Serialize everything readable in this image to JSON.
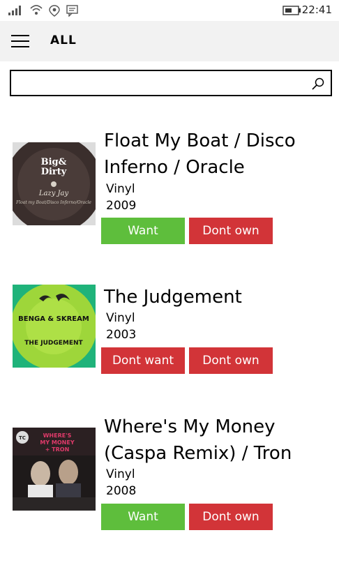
{
  "status_bar": {
    "time": "22:41"
  },
  "header": {
    "title": "ALL"
  },
  "search": {
    "value": "",
    "placeholder": ""
  },
  "items": [
    {
      "title": "Float My Boat / Disco Inferno / Oracle",
      "format": "Vinyl",
      "year": "2009",
      "want_label": "Want",
      "own_label": "Dont own",
      "cover": {
        "art_text": "Big & Dirty",
        "sub_text": "Lazy Jay"
      }
    },
    {
      "title": "The Judgement",
      "format": "Vinyl",
      "year": "2003",
      "want_label": "Dont want",
      "own_label": "Dont own",
      "cover": {
        "art_text": "BENGA & SKREAM",
        "sub_text": "THE JUDGEMENT"
      }
    },
    {
      "title": "Where's My Money (Caspa Remix) / Tron",
      "format": "Vinyl",
      "year": "2008",
      "want_label": "Want",
      "own_label": "Dont own",
      "cover": {
        "art_text": "WHERE'S MY MONEY + TRON",
        "sub_text": "TC"
      }
    }
  ],
  "colors": {
    "want": "#5ebe3c",
    "dont_want": "#d23438",
    "dont_own": "#d23438",
    "header_bg": "#f2f2f2"
  }
}
